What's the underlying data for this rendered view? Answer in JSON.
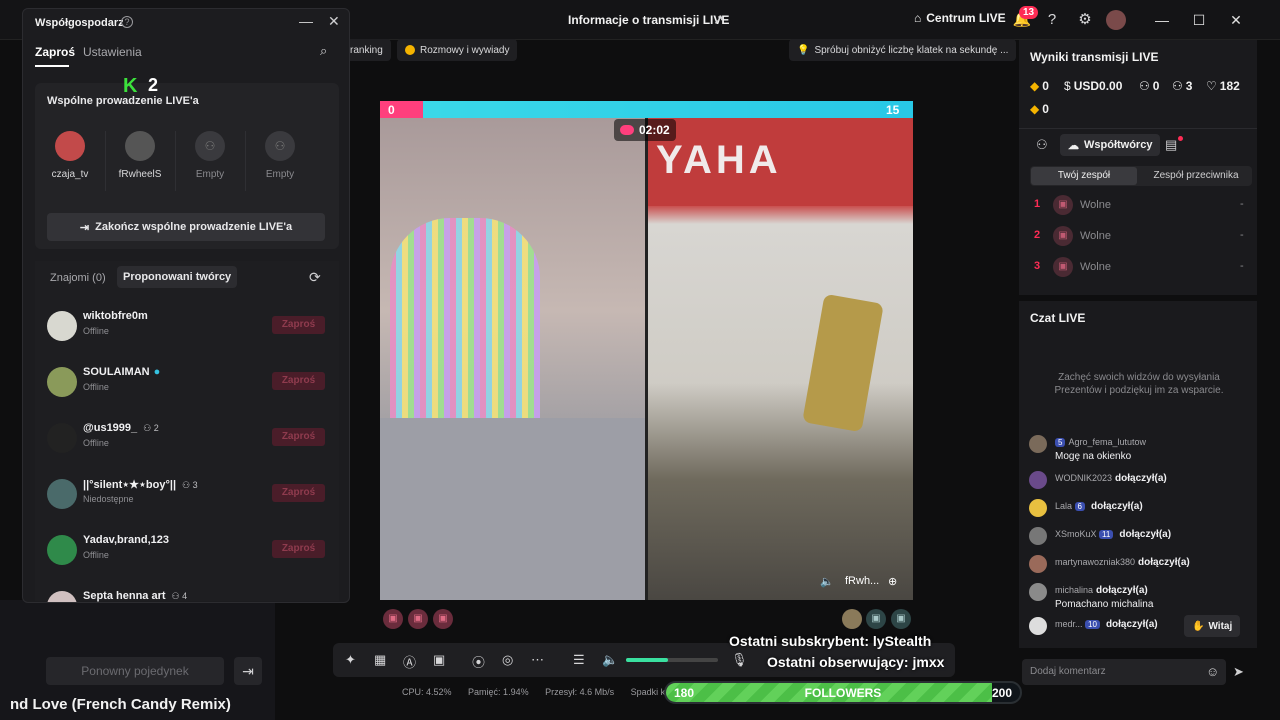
{
  "app": {
    "stream_info_title": "Informacje o transmisji LIVE",
    "live_center": "Centrum LIVE",
    "notifications_count": "13"
  },
  "chips": [
    {
      "label": "ranking"
    },
    {
      "label": "Rozmowy i wywiady"
    },
    {
      "label": "Spróbuj obniżyć liczbę klatek na sekundę ..."
    }
  ],
  "popup": {
    "title": "Współgospodarz",
    "tab_invite": "Zaproś",
    "tab_settings": "Ustawienia",
    "k2_number": "2",
    "cohost_section_title": "Wspólne prowadzenie LIVE'a",
    "slots": [
      {
        "name": "czaja_tv"
      },
      {
        "name": "fRwheelS"
      },
      {
        "name": "Empty"
      },
      {
        "name": "Empty"
      }
    ],
    "end_cohost_button": "Zakończ wspólne prowadzenie LIVE'a",
    "friends_tab": "Znajomi (0)",
    "suggested_tab": "Proponowani twórcy",
    "invite_label": "Zaproś",
    "creators": [
      {
        "name": "wiktobfre0m",
        "status": "Offline",
        "badge": ""
      },
      {
        "name": "SOULAIMAN",
        "status": "Offline",
        "badge": ""
      },
      {
        "name": "@us1999_",
        "status": "Offline",
        "badge": "2"
      },
      {
        "name": "||°silent⋆★⋆boy°||",
        "status": "Niedostępne",
        "badge": "3"
      },
      {
        "name": "Yadav,brand,123",
        "status": "Offline",
        "badge": ""
      },
      {
        "name": "Septa henna art",
        "status": "",
        "badge": "4"
      }
    ]
  },
  "under_popup": {
    "rematch_button": "Ponowny pojedynek",
    "song_title": "nd Love (French Candy Remix)"
  },
  "battle": {
    "score_left": "0",
    "score_right": "15",
    "timer": "02:02",
    "left_share": 0.08,
    "right_streamer": "fRwh..."
  },
  "stats": {
    "cpu": "CPU: 4.52%",
    "memory": "Pamięć: 1.94%",
    "bitrate": "Przesył: 4.6 Mb/s",
    "dropped": "Spadki k"
  },
  "overlay": {
    "last_sub": "Ostatni subskrybent: lyStealth",
    "last_follower": "Ostatni obserwujący: jmxx",
    "goal_start": "180",
    "goal_label": "FOLLOWERS",
    "goal_end": "200",
    "goal_progress": 0.92
  },
  "results": {
    "title": "Wyniki transmisji LIVE",
    "diamonds": "0",
    "usd": "USD0.00",
    "viewers": "0",
    "people": "3",
    "likes": "182",
    "second_diamonds": "0",
    "collaborators_button": "Współtwórcy",
    "your_team": "Twój zespół",
    "opponent_team": "Zespół przeciwnika",
    "ranks": [
      {
        "n": "1",
        "label": "Wolne",
        "value": "-"
      },
      {
        "n": "2",
        "label": "Wolne",
        "value": "-"
      },
      {
        "n": "3",
        "label": "Wolne",
        "value": "-"
      }
    ]
  },
  "chat": {
    "title": "Czat LIVE",
    "hint": "Zachęć swoich widzów do wysyłania Prezentów i podziękuj im za wsparcie.",
    "wave_button": "Witaj",
    "comment_placeholder": "Dodaj komentarz",
    "messages": [
      {
        "user": "Agro_fema_lututow",
        "level": "5",
        "text": "Mogę na okienko",
        "joined": ""
      },
      {
        "user": "WODNIK2023",
        "level": "",
        "text": "",
        "joined": "dołączył(a)"
      },
      {
        "user": "Lala",
        "level": "6",
        "text": "",
        "joined": "dołączył(a)"
      },
      {
        "user": "XSmoKuX",
        "level": "11",
        "text": "",
        "joined": "dołączył(a)"
      },
      {
        "user": "martynawozniak380",
        "level": "",
        "text": "",
        "joined": "dołączył(a)"
      },
      {
        "user": "michalina",
        "level": "",
        "text": "Pomachano michalina",
        "joined": "dołączył(a)"
      },
      {
        "user": "medr...",
        "level": "10",
        "text": "",
        "joined": "dołączył(a)"
      }
    ]
  }
}
